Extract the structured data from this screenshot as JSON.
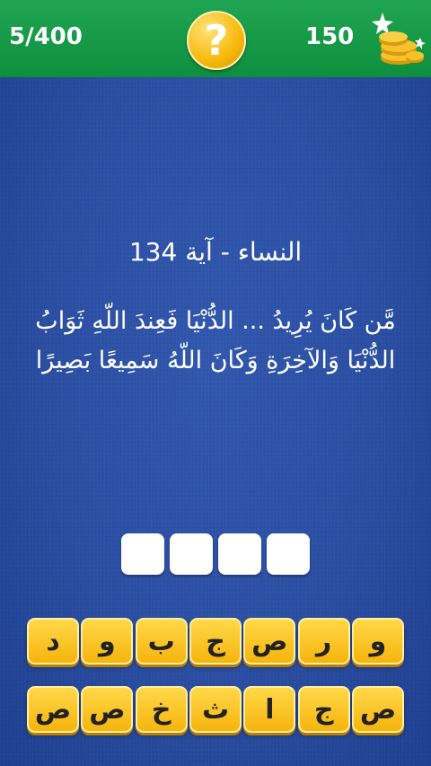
{
  "header": {
    "level": "5/400",
    "hint_symbol": "?",
    "coins": "150",
    "coin_icon": "coin-stack-icon"
  },
  "question": {
    "surah": "النساء - آية 134",
    "verse": "مَّن كَانَ يُرِيدُ ... الدُّنْيَا فَعِندَ اللّهِ ثَوَابُ الدُّنْيَا وَالآخِرَةِ وَكَانَ اللّهُ سَمِيعًا بَصِيرًا"
  },
  "answer_slots": 4,
  "letters": {
    "row1": [
      "و",
      "ر",
      "ص",
      "ج",
      "ب",
      "و",
      "د"
    ],
    "row2": [
      "ص",
      "ج",
      "ا",
      "ث",
      "خ",
      "ص",
      "ص"
    ]
  },
  "colors": {
    "header_green": "#0f8f3d",
    "board_blue": "#25479a",
    "key_gold": "#f6b40c"
  }
}
